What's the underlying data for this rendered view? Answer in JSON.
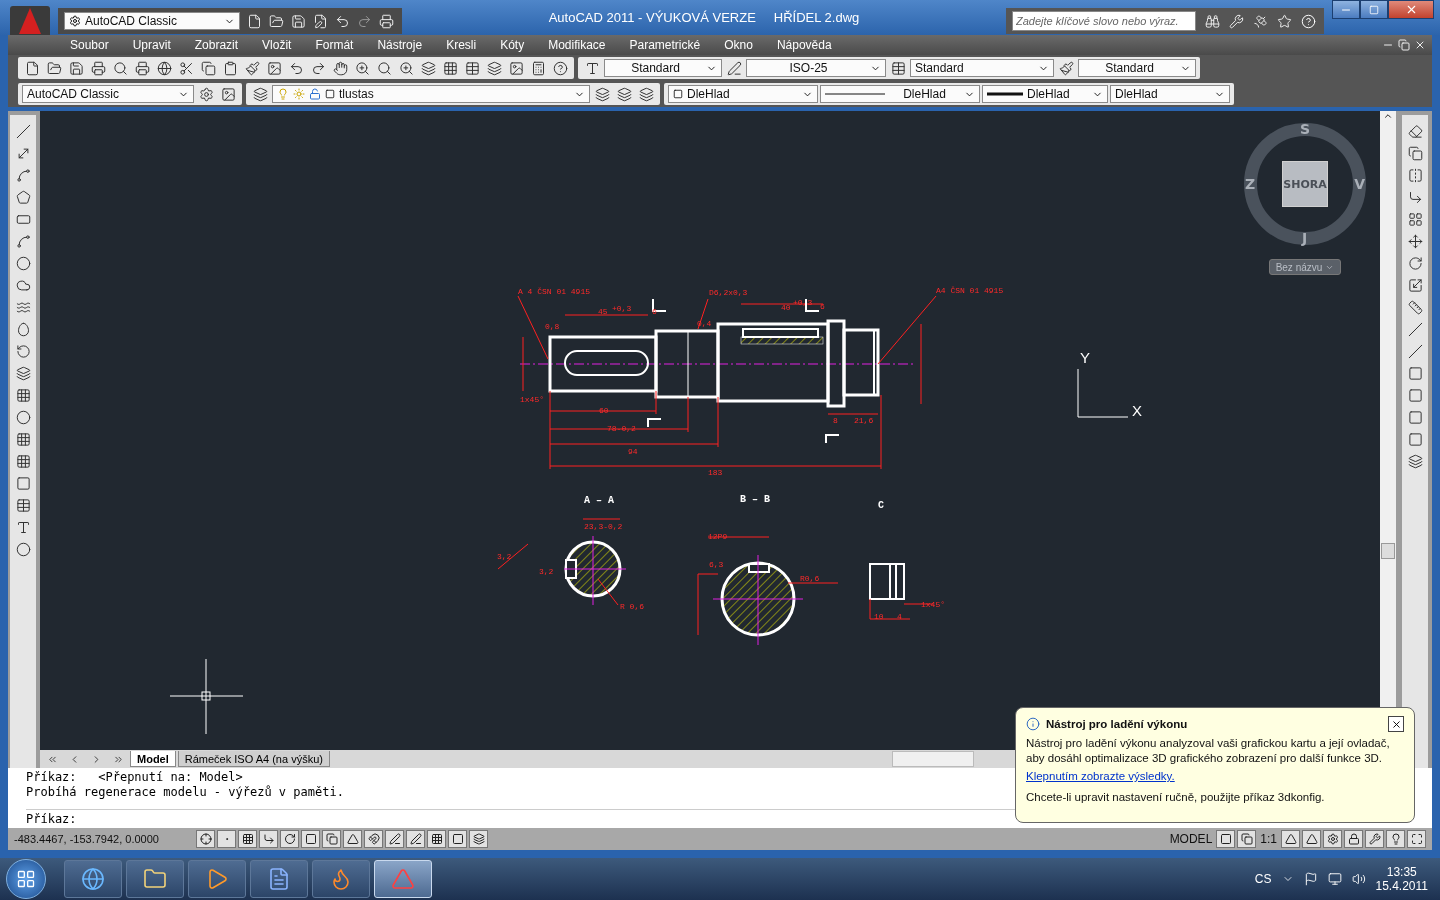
{
  "window": {
    "title": "AutoCAD 2011 - VÝUKOVÁ VERZE",
    "file": "HŘÍDEL 2.dwg"
  },
  "quick_access": {
    "workspace": "AutoCAD Classic"
  },
  "search": {
    "placeholder": "Zadejte klíčové slovo nebo výraz."
  },
  "menu": [
    "Soubor",
    "Upravit",
    "Zobrazit",
    "Vložit",
    "Formát",
    "Nástroje",
    "Kresli",
    "Kóty",
    "Modifikace",
    "Parametrické",
    "Okno",
    "Nápověda"
  ],
  "styles_toolbar": {
    "text_style": "Standard",
    "dim_style": "ISO-25",
    "table_style": "Standard",
    "mleader_style": "Standard"
  },
  "layers_toolbar": {
    "workspace": "AutoCAD Classic",
    "layer": "tlustas",
    "color_setting": "DleHlad",
    "linetype": "DleHlad",
    "lineweight": "DleHlad",
    "plot_style": "DleHlad"
  },
  "viewcube": {
    "north": "S",
    "west": "Z",
    "face": "SHORA",
    "east": "V",
    "south": "J",
    "ucs_menu": "Bez názvu"
  },
  "ucs_icon": {
    "y": "Y",
    "x": "X"
  },
  "dimension_labels": [
    "A 4 ČSN 01 4915",
    "D6,2x0,3",
    "A4 ČSN 01 4915",
    "45",
    "+0,3",
    "6",
    "40",
    "+0,3",
    "6",
    "0,8",
    "0,4",
    "60",
    "78-0,2",
    "94",
    "183",
    "8",
    "21,6",
    "1x45°",
    "23,3-0,2",
    "3,2",
    "3,2",
    "R 0,6",
    "12P9",
    "6,3",
    "R0,6",
    "10",
    "4",
    "1x45°"
  ],
  "section_titles": [
    "A – A",
    "B – B",
    "C"
  ],
  "layout_tabs": [
    {
      "label": "Model",
      "selected": true
    },
    {
      "label": "Rámeček ISO A4 (na výšku)",
      "selected": false
    }
  ],
  "command_history": [
    "Příkaz:   <Přepnutí na: Model>",
    "Probíhá regenerace modelu - výřezů v paměti."
  ],
  "command_prompt": "Příkaz:",
  "status_bar": {
    "coordinates": "-483.4467, -153.7942, 0.0000",
    "space": "MODEL",
    "scale": "1:1"
  },
  "balloon": {
    "title": "Nástroj pro ladění výkonu",
    "text": "Nástroj pro ladění výkonu analyzoval vaši grafickou kartu a její ovladač, aby dosáhl optimalizace 3D grafického zobrazení pro další funkce 3D.",
    "link": "Klepnutím zobrazte výsledky.",
    "note": "Chcete-li upravit nastavení ručně, použijte příkaz 3dkonfig."
  },
  "taskbar": {
    "language": "CS",
    "time": "13:35",
    "date": "15.4.2011",
    "apps": [
      {
        "kind": "browser",
        "selected": false
      },
      {
        "kind": "folder",
        "selected": false
      },
      {
        "kind": "media",
        "selected": false
      },
      {
        "kind": "word",
        "selected": false
      },
      {
        "kind": "firefox",
        "selected": false
      },
      {
        "kind": "autocad",
        "selected": true
      }
    ]
  }
}
